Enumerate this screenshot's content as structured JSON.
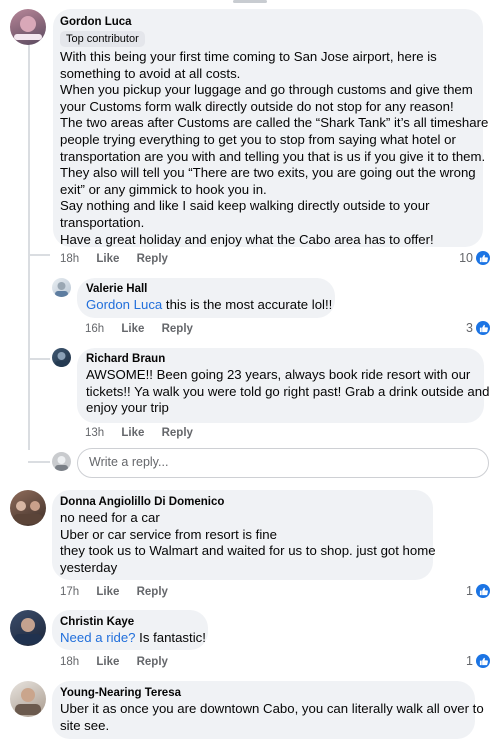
{
  "comments": [
    {
      "author": "Gordon Luca",
      "badge": "Top contributor",
      "lines": [
        "With this being your first time coming to San Jose airport, here is",
        "something to avoid at all costs.",
        "When you pickup your luggage and go through customs and give them",
        "your Customs form walk directly outside do not stop for any reason!",
        "The two areas after Customs are called the “Shark Tank” it’s all timeshare",
        "people trying everything to get you to stop from saying what hotel or",
        "transportation are you with and telling you that is us if you give it to them.",
        "They also will tell you “There are two exits, you are going out the wrong",
        "exit” or any gimmick to hook you in.",
        "Say nothing and like I said keep walking directly outside to your",
        "transportation.",
        "Have a great holiday and enjoy what the Cabo area has to offer!"
      ],
      "time": "18h",
      "like": "Like",
      "reply": "Reply",
      "reactions": "10"
    },
    {
      "author": "Valerie Hall",
      "mention": "Gordon Luca",
      "text": " this is the most accurate lol!!",
      "time": "16h",
      "like": "Like",
      "reply": "Reply",
      "reactions": "3"
    },
    {
      "author": "Richard Braun",
      "lines": [
        "AWSOME!! Been going 23 years, always book ride resort with our",
        "tickets!! Ya walk you were told go right past! Grab a drink outside and",
        "enjoy your trip"
      ],
      "time": "13h",
      "like": "Like",
      "reply": "Reply"
    },
    {
      "author": "Donna Angiolillo Di Domenico",
      "lines": [
        "no need for a car",
        "Uber or car service from resort is fine",
        "they took us to Walmart and waited for us to shop. just got home",
        "yesterday"
      ],
      "time": "17h",
      "like": "Like",
      "reply": "Reply",
      "reactions": "1"
    },
    {
      "author": "Christin Kaye",
      "mention": "Need a ride?",
      "text": " Is fantastic!",
      "time": "18h",
      "like": "Like",
      "reply": "Reply",
      "reactions": "1"
    },
    {
      "author": "Young-Nearing Teresa",
      "lines": [
        "Uber it as once you are downtown Cabo, you can literally walk all over to",
        "site see."
      ]
    }
  ],
  "reply_box": {
    "placeholder": "Write a reply..."
  },
  "icons": {
    "like": "like-thumb-icon"
  },
  "colors": {
    "accent": "#1b74e4",
    "bubble": "#f0f2f5"
  }
}
